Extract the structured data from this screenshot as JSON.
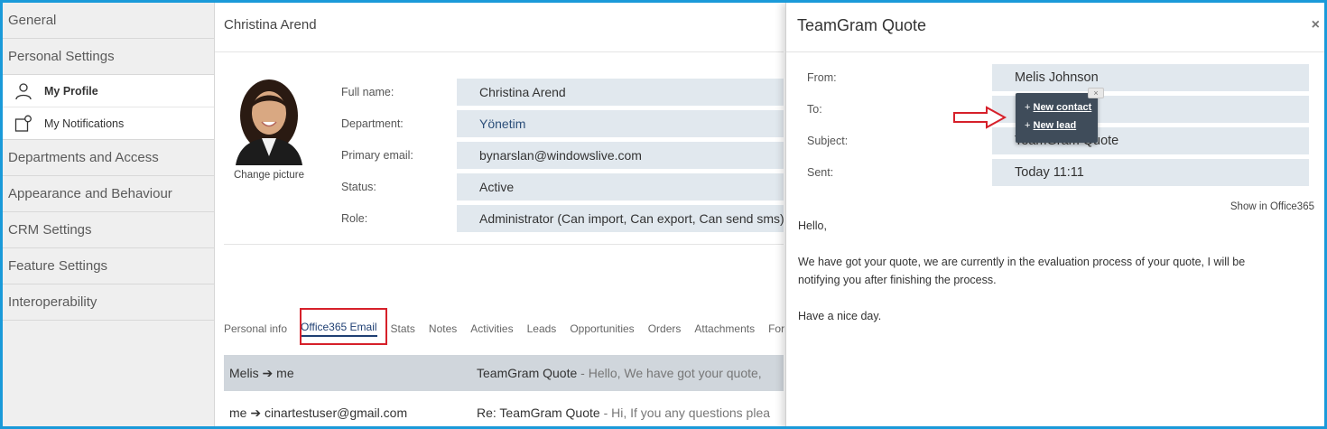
{
  "sidebar": {
    "items": [
      {
        "label": "General"
      },
      {
        "label": "Personal Settings"
      },
      {
        "label": "My Profile"
      },
      {
        "label": "My Notifications"
      },
      {
        "label": "Departments and Access"
      },
      {
        "label": "Appearance and Behaviour"
      },
      {
        "label": "CRM Settings"
      },
      {
        "label": "Feature Settings"
      },
      {
        "label": "Interoperability"
      }
    ]
  },
  "profile": {
    "title": "Christina Arend",
    "change_picture": "Change picture",
    "fields": [
      {
        "label": "Full name:",
        "value": "Christina Arend"
      },
      {
        "label": "Department:",
        "value": "Yönetim"
      },
      {
        "label": "Primary email:",
        "value": "bynarslan@windowslive.com"
      },
      {
        "label": "Status:",
        "value": "Active"
      },
      {
        "label": "Role:",
        "value": "Administrator (Can import, Can export, Can send sms)"
      }
    ],
    "tabs": [
      "Personal info",
      "Office365 Email",
      "Stats",
      "Notes",
      "Activities",
      "Leads",
      "Opportunities",
      "Orders",
      "Attachments",
      "Form"
    ],
    "active_tab": "Office365 Email",
    "emails": [
      {
        "from": "Melis ➔ me",
        "subject": "TeamGram Quote",
        "preview": " - Hello, We have got your quote, "
      },
      {
        "from": "me ➔ cinartestuser@gmail.com",
        "subject": "Re: TeamGram Quote",
        "preview": " - Hi, If you any questions plea"
      }
    ]
  },
  "panel": {
    "title": "TeamGram Quote",
    "fields": [
      {
        "label": "From:",
        "value": "Melis Johnson"
      },
      {
        "label": "To:",
        "value": ""
      },
      {
        "label": "Subject:",
        "value": "TeamGram Quote"
      },
      {
        "label": "Sent:",
        "value": "Today 11:11"
      }
    ],
    "show_in_office": "Show in Office365",
    "body": {
      "greeting": "Hello,",
      "line1": "We have got your quote, we are currently in the evaluation process of your quote, I will be",
      "line2": "notifying you after finishing the process.",
      "closing": "Have a nice day."
    },
    "popup": {
      "plus": "+",
      "new_contact": "New contact",
      "new_lead": "New lead",
      "close": "×"
    },
    "close": "×"
  },
  "colors": {
    "frame": "#1a9ad9",
    "highlight_box": "#d6202a",
    "field_bg": "#e1e8ee",
    "popup_bg": "#3f4c5a"
  }
}
